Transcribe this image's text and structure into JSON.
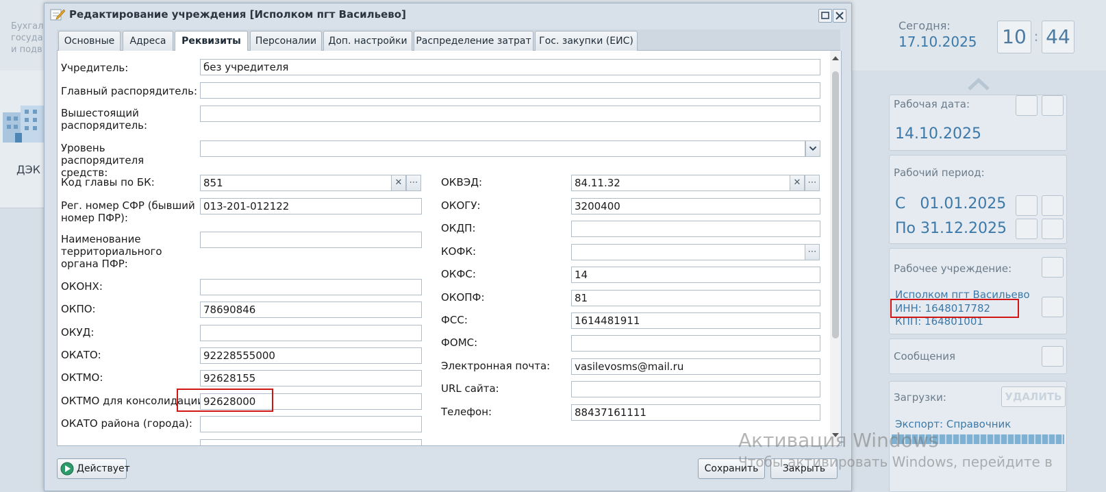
{
  "background": {
    "left_text": [
      "Бухгал",
      "госуда",
      "и подв"
    ],
    "left_tile_label": "ДЭК",
    "today_label": "Сегодня:",
    "today_date": "17.10.2025",
    "clock_hours": "10",
    "clock_minutes": "44",
    "work_date_label": "Рабочая дата:",
    "work_date": "14.10.2025",
    "work_period_label": "Рабочий период:",
    "period_from": "С   01.01.2025",
    "period_to": "По 31.12.2025",
    "work_org_label": "Рабочее учреждение:",
    "org_name": "Исполком пгт Васильево",
    "org_inn": "ИНН: 1648017782",
    "org_kpp": "КПП: 164801001",
    "messages_label": "Сообщения",
    "downloads_label": "Загрузки:",
    "delete_label": "УДАЛИТЬ",
    "export_label": "Экспорт: Справочник",
    "watermark_title": "Активация Windows",
    "watermark_sub": "Чтобы активировать Windows, перейдите в"
  },
  "dialog": {
    "title": "Редактирование учреждения [Исполком пгт Васильево]",
    "tabs": [
      {
        "label": "Основные"
      },
      {
        "label": "Адреса"
      },
      {
        "label": "Реквизиты"
      },
      {
        "label": "Персоналии"
      },
      {
        "label": "Доп. настройки"
      },
      {
        "label": "Распределение затрат"
      },
      {
        "label": "Гос. закупки (ЕИС)"
      }
    ],
    "active_tab": "Реквизиты",
    "fields": {
      "founder": {
        "label": "Учредитель:",
        "value": "без учредителя"
      },
      "main_manager": {
        "label": "Главный распорядитель:",
        "value": ""
      },
      "higher_manager": {
        "label": "Вышестоящий распорядитель:",
        "value": ""
      },
      "manager_level": {
        "label": "Уровень распорядителя средств:",
        "value": ""
      },
      "bk_code": {
        "label": "Код главы по БК:",
        "value": "851"
      },
      "sfr_number": {
        "label": "Рег. номер СФР (бывший номер ПФР):",
        "value": "013-201-012122"
      },
      "pfr_name": {
        "label": "Наименование территориального органа ПФР:",
        "value": ""
      },
      "okonh": {
        "label": "ОКОНХ:",
        "value": ""
      },
      "okpo": {
        "label": "ОКПО:",
        "value": "78690846"
      },
      "okud": {
        "label": "ОКУД:",
        "value": ""
      },
      "okato": {
        "label": "ОКАТО:",
        "value": "92228555000"
      },
      "oktmo": {
        "label": "ОКТМО:",
        "value": "92628155"
      },
      "oktmo_consol": {
        "label": "ОКТМО для консолидации:",
        "value": "92628000"
      },
      "okato_district": {
        "label": "ОКАТО района (города):",
        "value": ""
      },
      "okved": {
        "label": "ОКВЭД:",
        "value": "84.11.32"
      },
      "okogu": {
        "label": "ОКОГУ:",
        "value": "3200400"
      },
      "okdp": {
        "label": "ОКДП:",
        "value": ""
      },
      "kofk": {
        "label": "КОФК:",
        "value": ""
      },
      "okfs": {
        "label": "ОКФС:",
        "value": "14"
      },
      "okopf": {
        "label": "ОКОПФ:",
        "value": "81"
      },
      "fss": {
        "label": "ФСС:",
        "value": "1614481911"
      },
      "foms": {
        "label": "ФОМС:",
        "value": ""
      },
      "email": {
        "label": "Электронная почта:",
        "value": "vasilevosms@mail.ru"
      },
      "url": {
        "label": "URL сайта:",
        "value": ""
      },
      "phone": {
        "label": "Телефон:",
        "value": "88437161111"
      }
    },
    "status_button": "Действует",
    "save_button": "Сохранить",
    "close_button": "Закрыть"
  }
}
